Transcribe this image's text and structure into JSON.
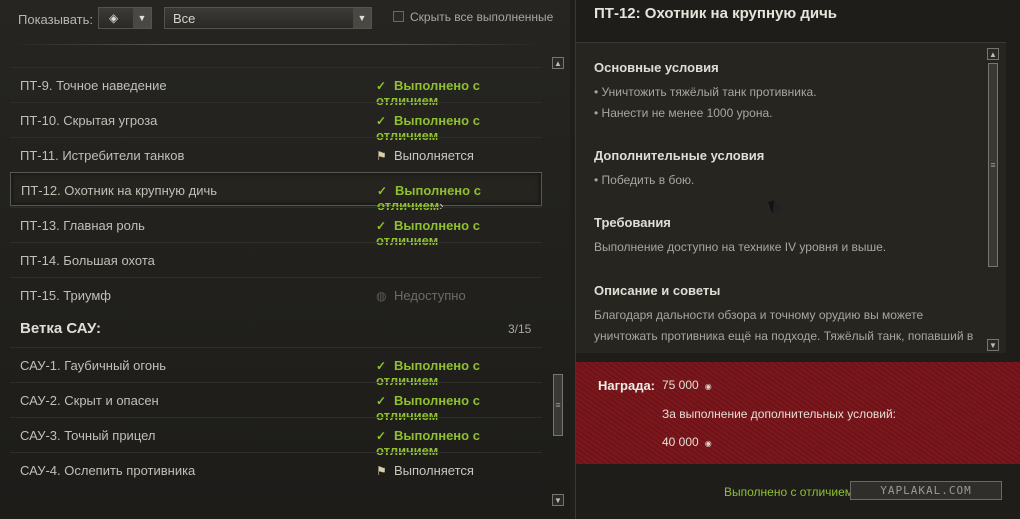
{
  "filters": {
    "show_label": "Показывать:",
    "type_value": "",
    "type_icon": "diamond-icon",
    "list_value": "Все",
    "hide_done_label": "Скрыть все выполненные"
  },
  "missions_top": [
    {
      "name": "ПТ-9. Точное наведение",
      "status": "Выполнено с отличием",
      "state": "done"
    },
    {
      "name": "ПТ-10. Скрытая угроза",
      "status": "Выполнено с отличием",
      "state": "done"
    },
    {
      "name": "ПТ-11. Истребители танков",
      "status": "Выполняется",
      "state": "progress"
    },
    {
      "name": "ПТ-12. Охотник на крупную дичь",
      "status": "Выполнено с отличием",
      "state": "done",
      "selected": true
    },
    {
      "name": "ПТ-13. Главная роль",
      "status": "Выполнено с отличием",
      "state": "done"
    },
    {
      "name": "ПТ-14. Большая охота",
      "status": "",
      "state": "none"
    },
    {
      "name": "ПТ-15. Триумф",
      "status": "Недоступно",
      "state": "na"
    }
  ],
  "branch": {
    "title": "Ветка САУ:",
    "count": "3/15"
  },
  "missions_bottom": [
    {
      "name": "САУ-1. Гаубичный огонь",
      "status": "Выполнено с отличием",
      "state": "done"
    },
    {
      "name": "САУ-2. Скрыт и опасен",
      "status": "Выполнено с отличием",
      "state": "done"
    },
    {
      "name": "САУ-3. Точный прицел",
      "status": "Выполнено с отличием",
      "state": "done"
    },
    {
      "name": "САУ-4. Ослепить противника",
      "status": "Выполняется",
      "state": "progress"
    }
  ],
  "detail": {
    "title": "ПТ-12: Охотник на крупную дичь",
    "main_header": "Основные условия",
    "main_1": "• Уничтожить тяжёлый танк противника.",
    "main_2": "• Нанести не менее 1000 урона.",
    "extra_header": "Дополнительные условия",
    "extra_1": "• Победить в бою.",
    "req_header": "Требования",
    "req_text": "Выполнение доступно на технике IV уровня и выше.",
    "desc_header": "Описание и советы",
    "desc_1": "Благодаря дальности обзора и точному орудию вы можете",
    "desc_2": "уничтожать противника ещё на подходе. Тяжёлый танк, попавший в"
  },
  "reward": {
    "label": "Награда:",
    "main_value": "75 000",
    "extra_label": "За выполнение дополнительных условий:",
    "extra_value": "40 000"
  },
  "bottom_status": "Выполнено с отличием",
  "watermark": "YAPLAKAL.COM",
  "colors": {
    "done": "#8fc02f",
    "reward_bg": "#7b171d"
  }
}
